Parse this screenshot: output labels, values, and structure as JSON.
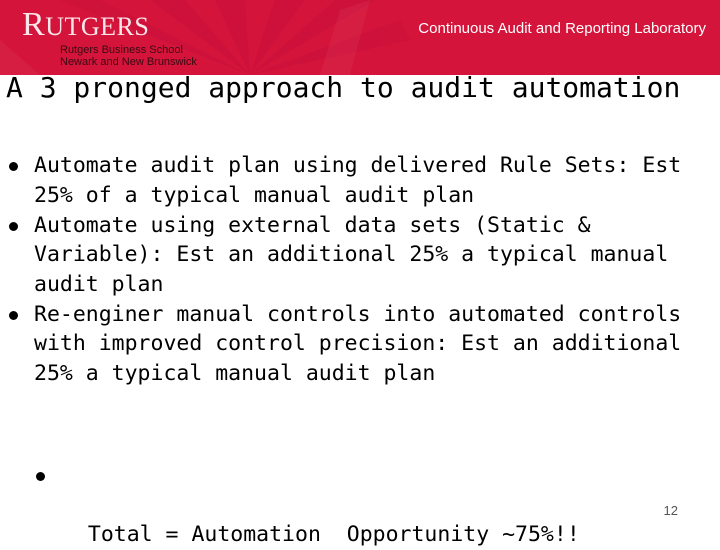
{
  "header": {
    "logo_text": "RUTGERS",
    "school_line1": "Rutgers Business School",
    "school_line2": "Newark and New Brunswick",
    "lab_title": "Continuous Audit and Reporting Laboratory",
    "background_color": "#d4143a"
  },
  "slide": {
    "title": "A 3 pronged approach to audit automation",
    "bullets": [
      {
        "icon": "bullet-dot",
        "text": "Automate audit plan using delivered Rule Sets:  Est 25% of a typical manual audit plan"
      },
      {
        "icon": "bullet-dot",
        "text": "Automate using external data sets (Static & Variable): Est an additional 25% a typical manual audit plan"
      },
      {
        "icon": "bullet-dot",
        "text": "Re-enginer manual controls into automated controls with improved control precision: Est an additional 25% a typical manual audit plan"
      }
    ],
    "sub_bullet": {
      "icon": "bullet-dot",
      "text": "Total = Automation  Opportunity ~75%!!"
    },
    "page_number": "12"
  }
}
